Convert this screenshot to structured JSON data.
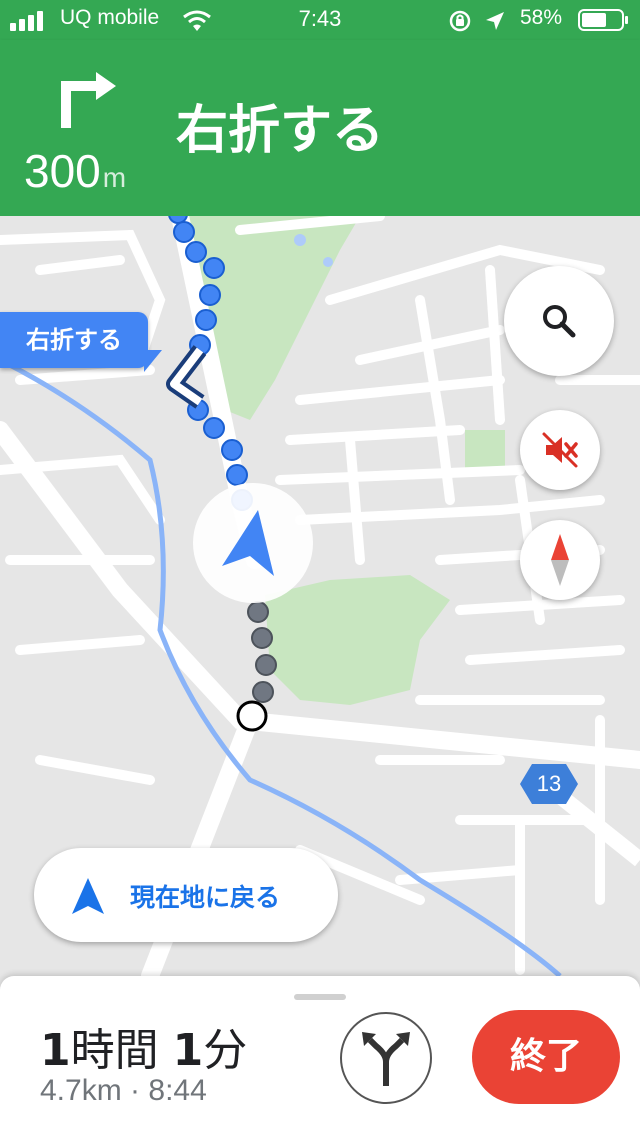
{
  "status_bar": {
    "carrier": "UQ mobile",
    "time": "7:43",
    "battery_percent": "58%",
    "icons": [
      "signal-icon",
      "wifi-icon",
      "orientation-lock-icon",
      "location-arrow-icon",
      "battery-icon"
    ]
  },
  "nav_banner": {
    "distance_value": "300",
    "distance_unit": "m",
    "instruction": "右折する",
    "maneuver_icon": "turn-right-arrow-icon",
    "background_color": "#34a853"
  },
  "map": {
    "turn_callout": "右折する",
    "route_shield": "13",
    "buttons": {
      "search_icon": "search-icon",
      "mute_icon": "sound-muted-icon",
      "compass_icon": "compass-icon"
    },
    "route_color": "#4285f4",
    "traveled_color": "#707782"
  },
  "recenter_button": {
    "label": "現在地に戻る",
    "icon": "navigation-arrow-icon"
  },
  "bottom_sheet": {
    "duration": {
      "hours_number": "1",
      "hours_unit": "時間",
      "minutes_number": "1",
      "minutes_unit": "分"
    },
    "distance": "4.7km",
    "separator": "·",
    "arrival_time": "8:44",
    "alt_routes_icon": "alternate-routes-icon",
    "end_button_label": "終了",
    "end_button_color": "#ea4335"
  }
}
